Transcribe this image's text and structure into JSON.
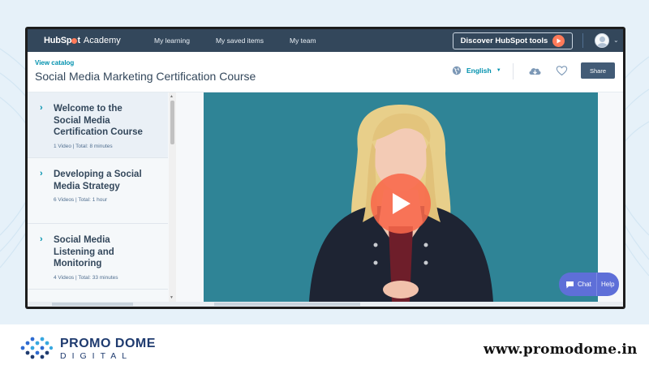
{
  "nav": {
    "brand_logo_left": "HubSp",
    "brand_logo_right": "t",
    "brand_suffix": "Academy",
    "links": [
      "My learning",
      "My saved items",
      "My team"
    ],
    "discover_button": "Discover HubSpot tools"
  },
  "header": {
    "view_catalog": "View catalog",
    "course_title": "Social Media Marketing Certification Course",
    "language": "English",
    "share_button": "Share"
  },
  "lessons": [
    {
      "title_lines": [
        "Welcome to the",
        "Social Media",
        "Certification Course"
      ],
      "meta": "1 Video | Total: 8 minutes",
      "active": true
    },
    {
      "title_lines": [
        "Developing a Social",
        "Media Strategy"
      ],
      "meta": "6 Videos | Total: 1 hour",
      "active": false
    },
    {
      "title_lines": [
        "Social Media",
        "Listening and",
        "Monitoring"
      ],
      "meta": "4 Videos | Total: 33 minutes",
      "active": false
    }
  ],
  "chat": {
    "chat_label": "Chat",
    "help_label": "Help"
  },
  "footer": {
    "brand_bold": "PROMO DOME",
    "brand_sub": "DIGITAL",
    "url": "www.promodome.in"
  },
  "colors": {
    "nav_bg": "#33475b",
    "accent": "#0091ae",
    "play_orange": "#ff7a59",
    "video_bg": "#2f8496",
    "share_bg": "#425b76",
    "chat_bg": "#5e6fd8"
  }
}
